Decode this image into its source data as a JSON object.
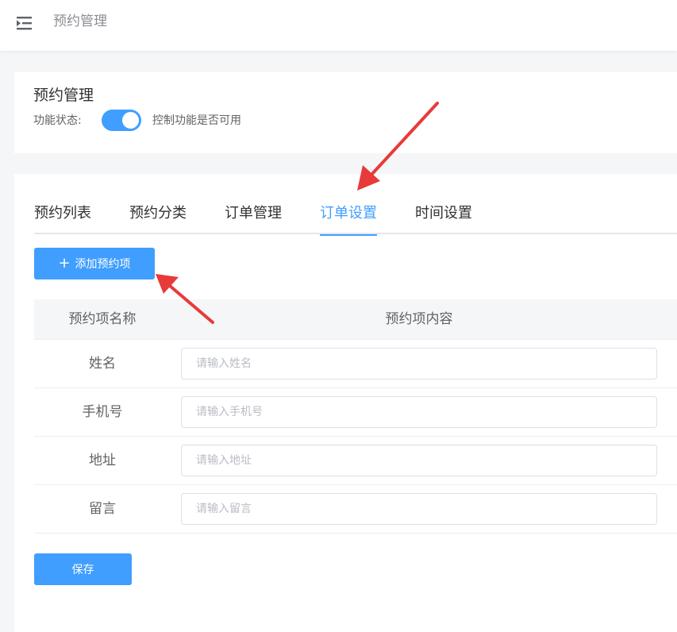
{
  "header": {
    "title": "预约管理",
    "menu_icon": "menu-fold-icon"
  },
  "feature_card": {
    "title": "预约管理",
    "status_label": "功能状态:",
    "switch_on": true,
    "switch_desc": "控制功能是否可用"
  },
  "tabs": [
    {
      "label": "预约列表",
      "active": false
    },
    {
      "label": "预约分类",
      "active": false
    },
    {
      "label": "订单管理",
      "active": false
    },
    {
      "label": "订单设置",
      "active": true
    },
    {
      "label": "时间设置",
      "active": false
    }
  ],
  "add_button": {
    "icon": "plus-icon",
    "label": "添加预约项"
  },
  "table": {
    "headers": [
      "预约项名称",
      "预约项内容"
    ],
    "rows": [
      {
        "name": "姓名",
        "placeholder": "请输入姓名",
        "value": ""
      },
      {
        "name": "手机号",
        "placeholder": "请输入手机号",
        "value": ""
      },
      {
        "name": "地址",
        "placeholder": "请输入地址",
        "value": ""
      },
      {
        "name": "留言",
        "placeholder": "请输入留言",
        "value": ""
      }
    ]
  },
  "save_button": {
    "label": "保存"
  },
  "colors": {
    "primary": "#409eff",
    "annotation_arrow": "#e83a3a",
    "page_background": "#f5f6f8"
  }
}
